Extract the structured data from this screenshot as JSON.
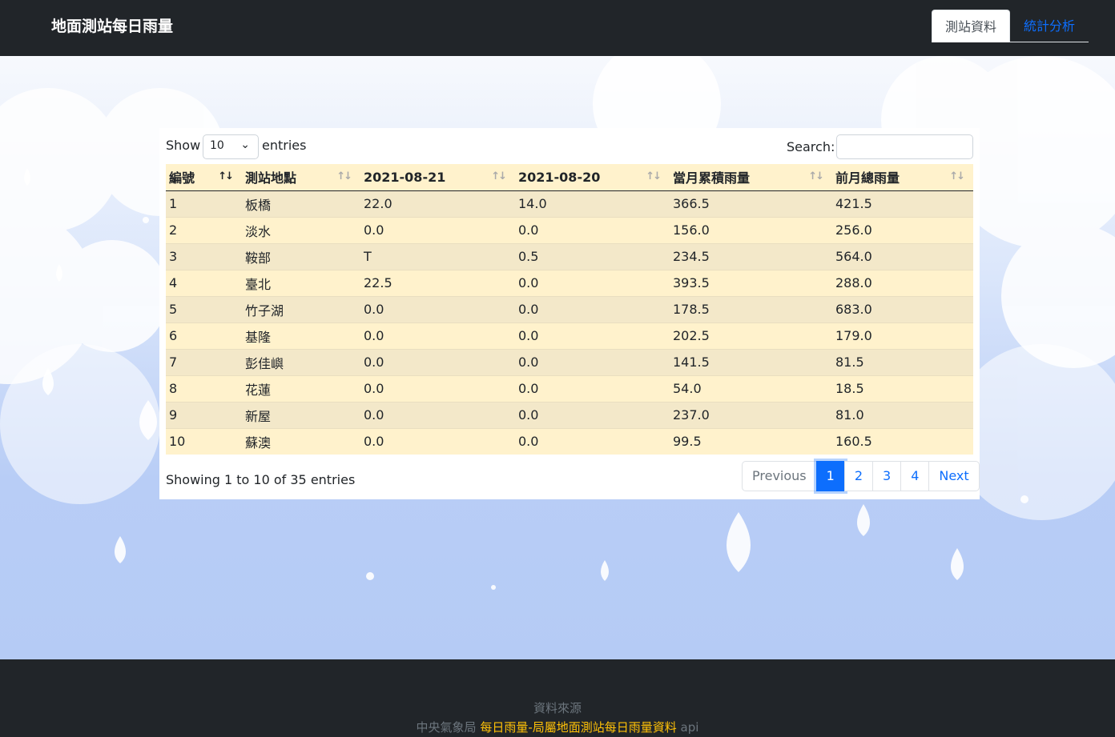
{
  "header": {
    "brand": "地面測站每日雨量",
    "tabs": [
      "測站資料",
      "統計分析"
    ]
  },
  "table_controls": {
    "show": "Show",
    "length_value": "10",
    "entries": "entries",
    "search_label": "Search:"
  },
  "table": {
    "columns": [
      "編號",
      "測站地點",
      "2021-08-21",
      "2021-08-20",
      "當月累積雨量",
      "前月總雨量"
    ],
    "rows": [
      [
        "1",
        "板橋",
        "22.0",
        "14.0",
        "366.5",
        "421.5"
      ],
      [
        "2",
        "淡水",
        "0.0",
        "0.0",
        "156.0",
        "256.0"
      ],
      [
        "3",
        "鞍部",
        "T",
        "0.5",
        "234.5",
        "564.0"
      ],
      [
        "4",
        "臺北",
        "22.5",
        "0.0",
        "393.5",
        "288.0"
      ],
      [
        "5",
        "竹子湖",
        "0.0",
        "0.0",
        "178.5",
        "683.0"
      ],
      [
        "6",
        "基隆",
        "0.0",
        "0.0",
        "202.5",
        "179.0"
      ],
      [
        "7",
        "彭佳嶼",
        "0.0",
        "0.0",
        "141.5",
        "81.5"
      ],
      [
        "8",
        "花蓮",
        "0.0",
        "0.0",
        "54.0",
        "18.5"
      ],
      [
        "9",
        "新屋",
        "0.0",
        "0.0",
        "237.0",
        "81.0"
      ],
      [
        "10",
        "蘇澳",
        "0.0",
        "0.0",
        "99.5",
        "160.5"
      ]
    ]
  },
  "info": "Showing 1 to 10 of 35 entries",
  "pagination": {
    "previous": "Previous",
    "pages": [
      "1",
      "2",
      "3",
      "4"
    ],
    "current": "1",
    "next": "Next"
  },
  "footer": {
    "title": "資料來源",
    "prefix": "中央氣象局",
    "link": "每日雨量-局屬地面測站每日雨量資料",
    "suffix": "api"
  },
  "colors": {
    "navbar": "#212529",
    "row_odd": "#f3e8c9",
    "row_even": "#fff2cc",
    "accent": "#0d6efd",
    "footer_link": "#ffc107"
  }
}
